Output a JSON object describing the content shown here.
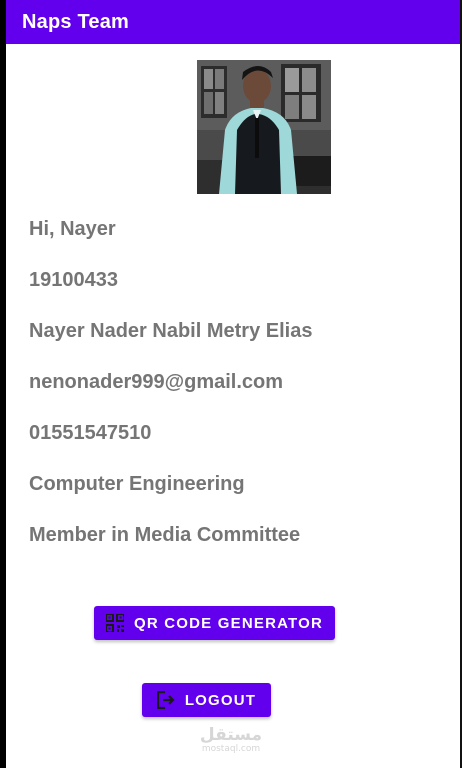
{
  "app_bar": {
    "title": "Naps Team",
    "color": "#6200ee"
  },
  "profile": {
    "photo_icon": "profile-photo",
    "greeting": "Hi, Nayer",
    "student_id": "19100433",
    "full_name": "Nayer Nader Nabil Metry Elias",
    "email": "nenonader999@gmail.com",
    "phone": "01551547510",
    "department": "Computer Engineering",
    "role": "Member in Media Committee",
    "text_color": "#757575"
  },
  "buttons": {
    "qr_label": "QR CODE GENERATOR",
    "qr_icon": "qr-code-icon",
    "logout_label": "LOGOUT",
    "logout_icon": "logout-icon",
    "color": "#6200ee"
  },
  "watermark": {
    "main": "مستقل",
    "sub": "mostaql.com"
  }
}
